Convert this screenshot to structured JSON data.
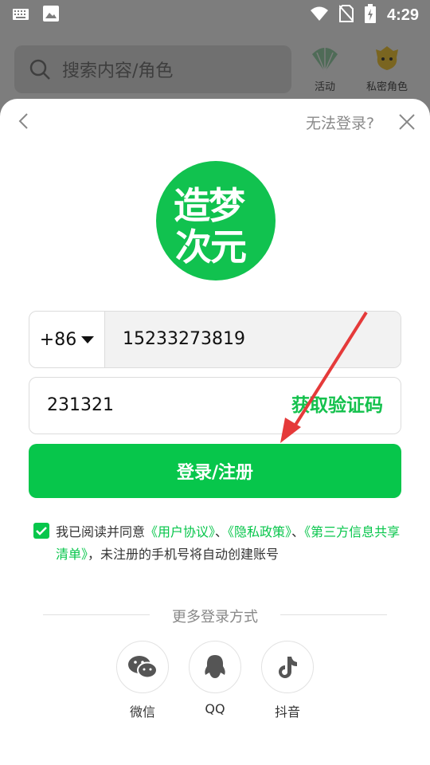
{
  "status_bar": {
    "time": "4:29"
  },
  "background_app": {
    "search_placeholder": "搜索内容/角色",
    "icons": [
      {
        "label": "活动",
        "icon": "fan-icon"
      },
      {
        "label": "私密角色",
        "icon": "mascot-icon"
      }
    ]
  },
  "sheet": {
    "cant_login": "无法登录?",
    "logo": {
      "line1": "造梦",
      "line2": "次元"
    },
    "phone": {
      "country_code": "+86",
      "number": "15233273819"
    },
    "code": {
      "value": "231321",
      "get_code": "获取验证码"
    },
    "login_button": "登录/注册",
    "agreement": {
      "prefix": "我已阅读并同意",
      "link1": "《用户协议》",
      "sep1": "、",
      "link2": "《隐私政策》",
      "sep2": "、",
      "link3": "《第三方信息共享清单》",
      "suffix": "，未注册的手机号将自动创建账号"
    },
    "more_login": "更多登录方式",
    "social": [
      {
        "label": "微信",
        "icon": "wechat-icon"
      },
      {
        "label": "QQ",
        "icon": "qq-icon"
      },
      {
        "label": "抖音",
        "icon": "douyin-icon"
      }
    ]
  },
  "colors": {
    "accent": "#07c64b",
    "overlay": "#7d7d7d",
    "arrow": "#e53a3a"
  }
}
